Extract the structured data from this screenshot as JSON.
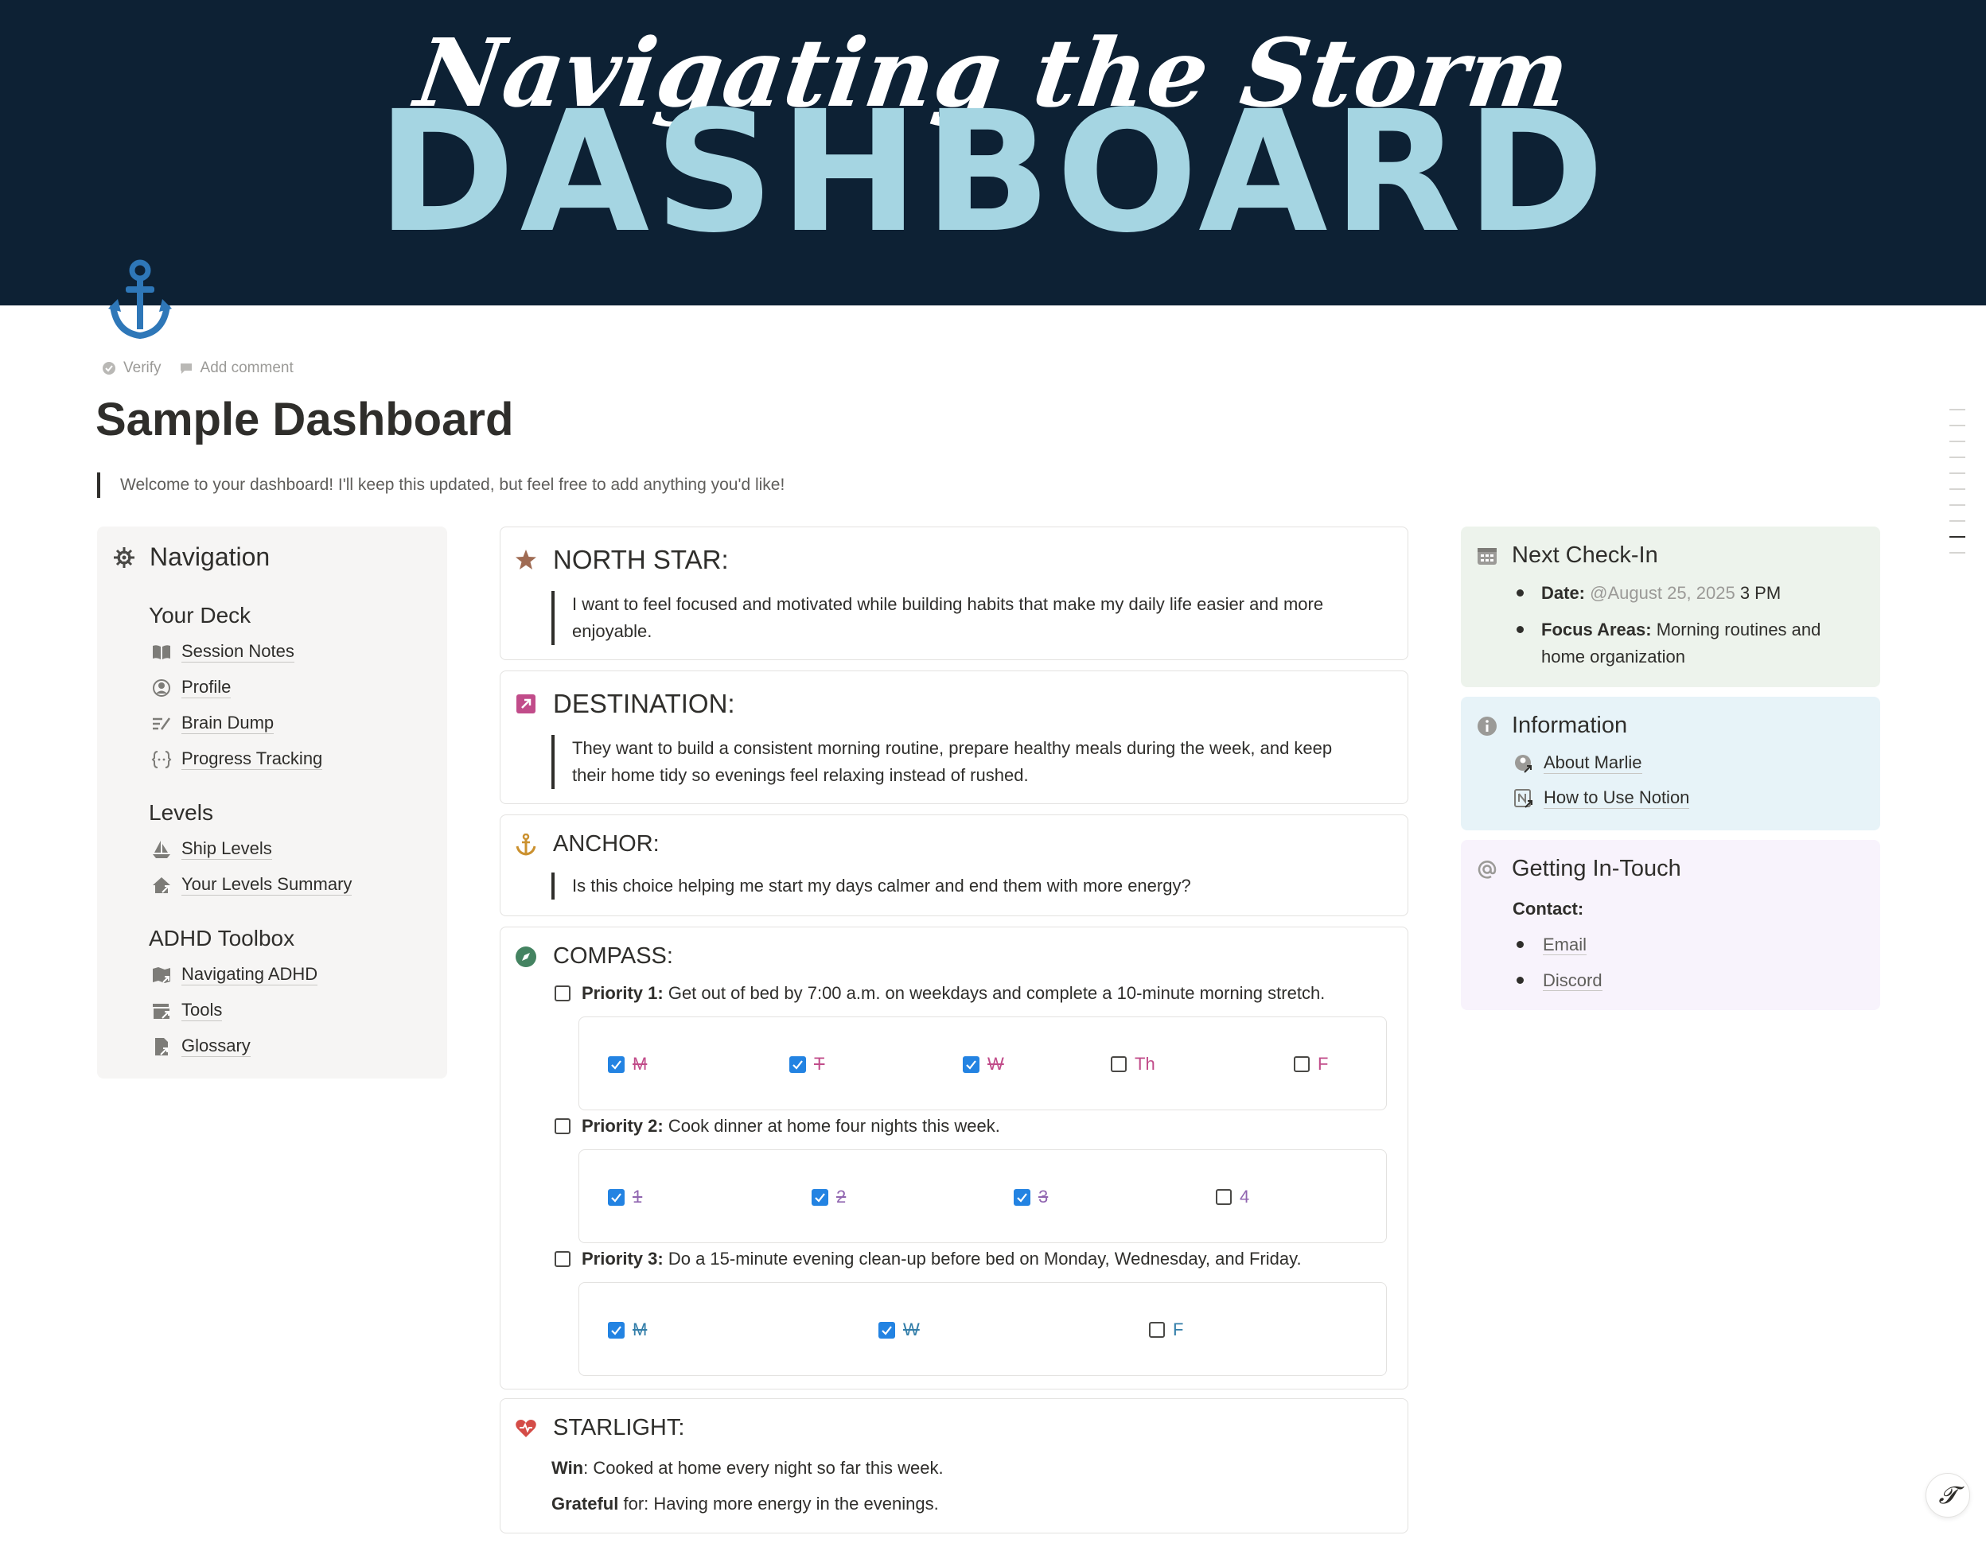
{
  "banner": {
    "script_title": "Navigating the Storm",
    "big_title": "DASHBOARD"
  },
  "meta": {
    "verify": "Verify",
    "add_comment": "Add comment"
  },
  "page": {
    "title": "Sample Dashboard",
    "intro": "Welcome to your dashboard! I'll keep this updated, but feel free to add anything you'd like!"
  },
  "nav": {
    "heading": "Navigation",
    "sections": [
      {
        "title": "Your Deck",
        "items": [
          "Session Notes",
          "Profile",
          "Brain Dump",
          "Progress Tracking"
        ]
      },
      {
        "title": "Levels",
        "items": [
          "Ship Levels",
          "Your Levels Summary"
        ]
      },
      {
        "title": "ADHD Toolbox",
        "items": [
          "Navigating ADHD",
          "Tools",
          "Glossary"
        ]
      }
    ]
  },
  "north_star": {
    "heading": "NORTH STAR:",
    "line1": "I want to feel focused and motivated while building habits that make my daily life easier and more",
    "line2": "enjoyable."
  },
  "destination": {
    "heading": "DESTINATION:",
    "line1": "They want to build a consistent morning routine, prepare healthy meals during the week, and keep",
    "line2": "their home tidy so evenings feel relaxing instead of rushed."
  },
  "anchor": {
    "heading": "ANCHOR:",
    "text": "Is this choice helping me start my days calmer and end them with more energy?"
  },
  "compass": {
    "heading": "COMPASS:",
    "priorities": [
      {
        "label": "Priority 1:",
        "text": "Get out of bed by 7:00 a.m. on weekdays and complete a 10-minute morning stretch.",
        "days": [
          {
            "t": "M",
            "done": true
          },
          {
            "t": "T",
            "done": true
          },
          {
            "t": "W",
            "done": true
          },
          {
            "t": "Th",
            "done": false
          },
          {
            "t": "F",
            "done": false
          }
        ]
      },
      {
        "label": "Priority 2:",
        "text": "Cook dinner at home four nights this week.",
        "days": [
          {
            "t": "1",
            "done": true
          },
          {
            "t": "2",
            "done": true
          },
          {
            "t": "3",
            "done": true
          },
          {
            "t": "4",
            "done": false
          }
        ]
      },
      {
        "label": "Priority 3:",
        "text": "Do a 15-minute evening clean-up before bed on Monday, Wednesday, and Friday.",
        "days": [
          {
            "t": "M",
            "done": true
          },
          {
            "t": "W",
            "done": true
          },
          {
            "t": "F",
            "done": false
          }
        ]
      }
    ]
  },
  "starlight": {
    "heading": "STARLIGHT:",
    "win_label": "Win",
    "win_text": ": Cooked at home every night so far this week.",
    "grateful_label": "Grateful",
    "grateful_text": " for: Having more energy in the evenings."
  },
  "checkin": {
    "heading": "Next Check-In",
    "date_label": "Date:",
    "date_mention": "@August 25, 2025",
    "date_time": " 3 PM",
    "focus_label": "Focus Areas:",
    "focus_line1": " Morning routines and",
    "focus_line2": "home organization"
  },
  "information": {
    "heading": "Information",
    "links": [
      "About Marlie",
      "How to Use Notion"
    ]
  },
  "contact": {
    "heading": "Getting In-Touch",
    "label": "Contact:",
    "links": [
      "Email",
      "Discord"
    ]
  },
  "colors": {
    "banner_bg": "#0d2134",
    "banner_accent": "#a5d5e2",
    "checkbox_blue": "#2383e2",
    "checkin_bg": "#edf3ec",
    "info_bg": "#e7f3f8",
    "contact_bg": "#f8f3fc",
    "pink": "#c14c8a",
    "purple": "#9065b0",
    "blue": "#337ea9"
  },
  "icons": {
    "page": "anchor-icon",
    "nav": "ship-wheel-icon",
    "north_star": "star-icon",
    "destination": "arrow-up-right-icon",
    "anchor": "anchor-icon",
    "compass": "compass-icon",
    "starlight": "heart-icon",
    "checkin": "calendar-icon",
    "information": "info-icon",
    "contact": "at-icon"
  }
}
